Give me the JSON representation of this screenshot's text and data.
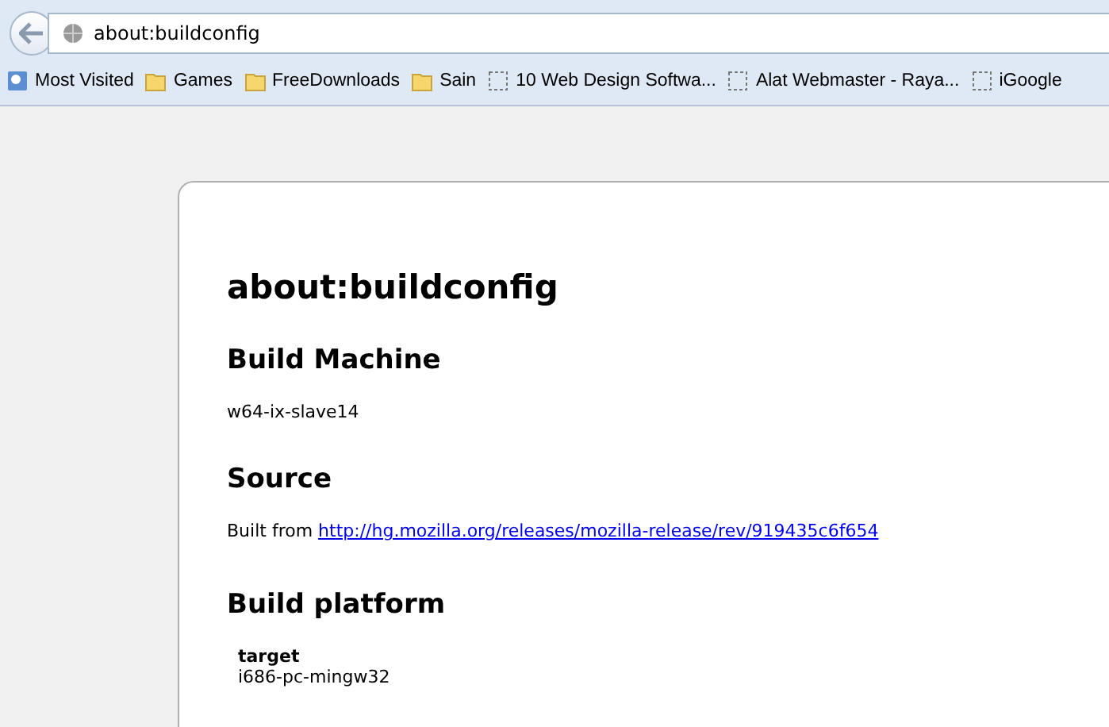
{
  "address_bar": {
    "url": "about:buildconfig"
  },
  "bookmarks": [
    {
      "label": "Most Visited",
      "kind": "smart"
    },
    {
      "label": "Games",
      "kind": "folder"
    },
    {
      "label": "FreeDownloads",
      "kind": "folder"
    },
    {
      "label": "Sain",
      "kind": "folder"
    },
    {
      "label": "10 Web Design Softwa...",
      "kind": "page"
    },
    {
      "label": "Alat Webmaster - Raya...",
      "kind": "page"
    },
    {
      "label": "iGoogle",
      "kind": "page"
    }
  ],
  "page": {
    "title": "about:buildconfig",
    "sections": [
      {
        "heading": "Build Machine",
        "kind": "text",
        "text": "w64-ix-slave14"
      },
      {
        "heading": "Source",
        "kind": "link",
        "text": "Built from",
        "link": "http://hg.mozilla.org/releases/mozilla-release/rev/919435c6f654"
      },
      {
        "heading": "Build platform",
        "kind": "table",
        "column": "target",
        "value": "i686-pc-mingw32"
      }
    ]
  }
}
